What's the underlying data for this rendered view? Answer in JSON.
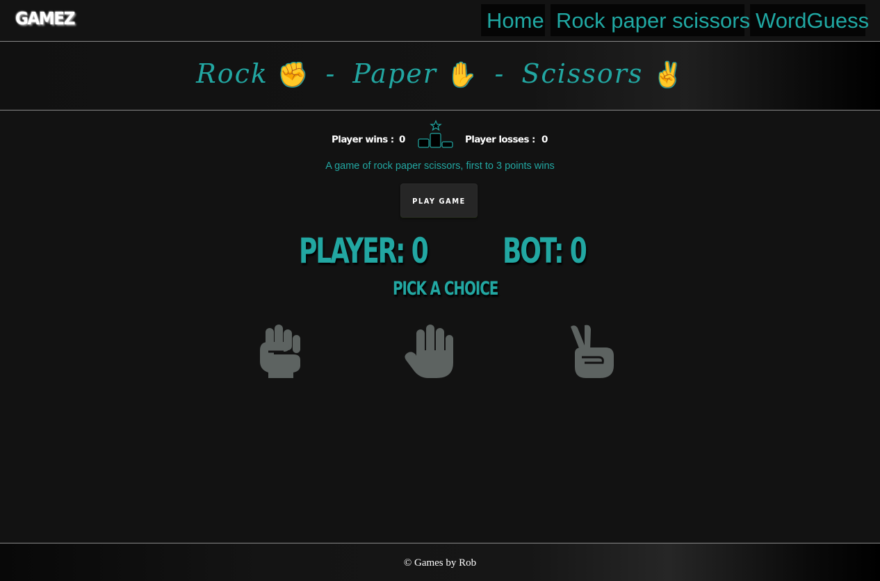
{
  "nav": {
    "brand": "GAMEZ",
    "links": [
      {
        "label": "Home"
      },
      {
        "label": "Rock paper scissors"
      },
      {
        "label": "WordGuess"
      }
    ]
  },
  "header": {
    "title_parts": [
      "Rock",
      "Paper",
      "Scissors"
    ],
    "separator": "-",
    "hand_icons": [
      "raised-fist-icon",
      "raised-hand-icon",
      "victory-hand-icon"
    ]
  },
  "stats": {
    "wins_label": "Player wins :",
    "wins_value": "0",
    "losses_label": "Player losses :",
    "losses_value": "0",
    "icon": "podium-icon"
  },
  "tagline": "A game of rock paper scissors, first to 3 points wins",
  "play_button": "PLAY GAME",
  "scoreboard": {
    "player": "Player: 0",
    "bot": "Bot: 0",
    "prompt": "Pick a choice"
  },
  "choices": [
    {
      "name": "rock",
      "icon": "raised-fist-icon"
    },
    {
      "name": "paper",
      "icon": "raised-hand-icon"
    },
    {
      "name": "scissors",
      "icon": "victory-hand-icon"
    }
  ],
  "footer": {
    "text": "© Games by Rob"
  },
  "colors": {
    "accent": "#22a7a2",
    "background": "#121212",
    "icon_gray": "#5d6361"
  }
}
